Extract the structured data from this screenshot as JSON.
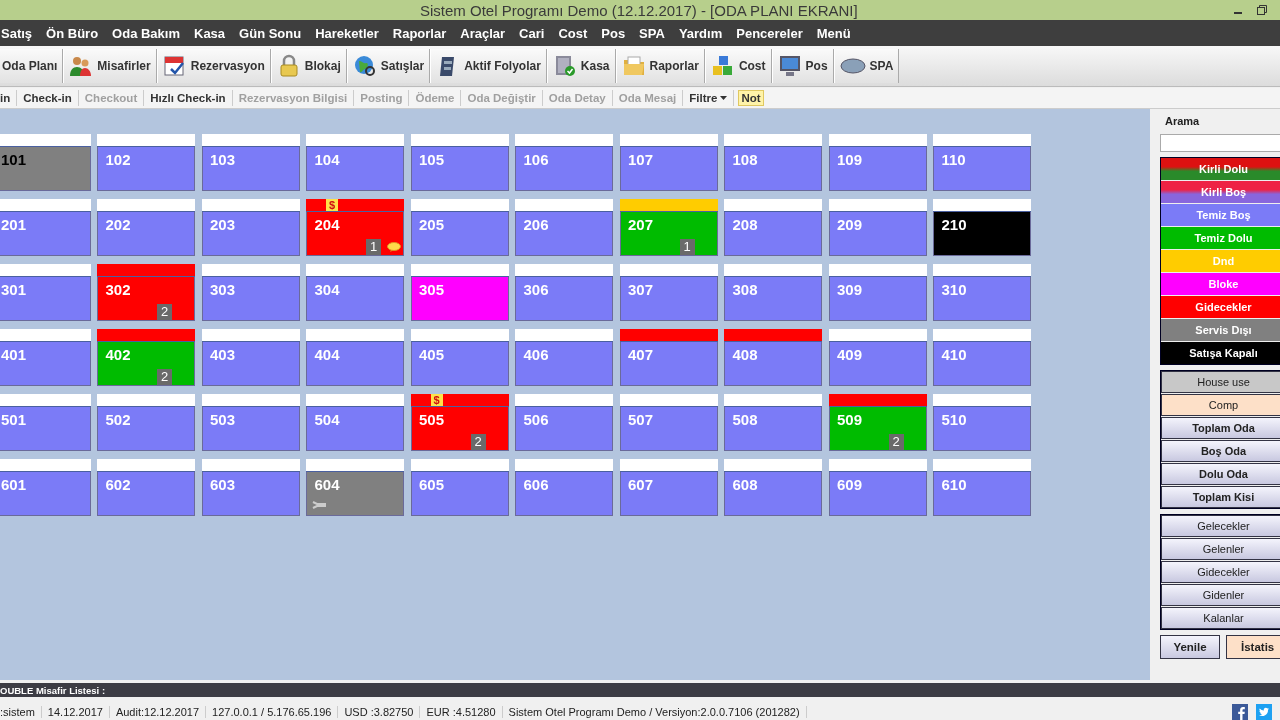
{
  "window": {
    "title": "Sistem Otel Programı Demo (12.12.2017) - [ODA PLANI EKRANI]"
  },
  "menu": [
    "Satış",
    "Ön Büro",
    "Oda Bakım",
    "Kasa",
    "Gün Sonu",
    "Hareketler",
    "Raporlar",
    "Araçlar",
    "Cari",
    "Cost",
    "Pos",
    "SPA",
    "Yardım",
    "Pencereler",
    "Menü"
  ],
  "toolbar": [
    {
      "label": "Oda Planı",
      "kind": "none"
    },
    {
      "label": "Misafirler",
      "kind": "people"
    },
    {
      "label": "Rezervasyon",
      "kind": "calendar"
    },
    {
      "label": "Blokaj",
      "kind": "lock"
    },
    {
      "label": "Satışlar",
      "kind": "globe"
    },
    {
      "label": "Aktif Folyolar",
      "kind": "cabinet"
    },
    {
      "label": "Kasa",
      "kind": "safe"
    },
    {
      "label": "Raporlar",
      "kind": "folder"
    },
    {
      "label": "Cost",
      "kind": "cubes"
    },
    {
      "label": "Pos",
      "kind": "monitor"
    },
    {
      "label": "SPA",
      "kind": "oval"
    }
  ],
  "actions": [
    {
      "label": "in",
      "disabled": false,
      "kind": "item"
    },
    {
      "label": "Check-in",
      "disabled": false,
      "kind": "item"
    },
    {
      "label": "Checkout",
      "disabled": true,
      "kind": "item"
    },
    {
      "label": "Hızlı Check-in",
      "disabled": false,
      "kind": "item"
    },
    {
      "label": "Rezervasyon Bilgisi",
      "disabled": true,
      "kind": "item"
    },
    {
      "label": "Posting",
      "disabled": true,
      "kind": "item"
    },
    {
      "label": "Ödeme",
      "disabled": true,
      "kind": "item"
    },
    {
      "label": "Oda Değiştir",
      "disabled": true,
      "kind": "item"
    },
    {
      "label": "Oda Detay",
      "disabled": true,
      "kind": "item"
    },
    {
      "label": "Oda Mesaj",
      "disabled": true,
      "kind": "item"
    },
    {
      "label": "Filtre",
      "disabled": false,
      "kind": "dropdown"
    },
    {
      "label": "Not",
      "disabled": false,
      "kind": "highlight"
    }
  ],
  "rooms": [
    [
      {
        "no": "101",
        "color": "#808080",
        "strip": {
          "color": "#ffffff"
        },
        "selected": true
      },
      {
        "no": "102",
        "color": "#7b7bf7",
        "strip": {
          "color": "#ffffff"
        },
        "selected": false
      },
      {
        "no": "103",
        "color": "#7b7bf7",
        "strip": {
          "color": "#ffffff"
        },
        "selected": false
      },
      {
        "no": "104",
        "color": "#7b7bf7",
        "strip": {
          "color": "#ffffff"
        },
        "selected": false
      },
      {
        "no": "105",
        "color": "#7b7bf7",
        "strip": {
          "color": "#ffffff"
        },
        "selected": false
      },
      {
        "no": "106",
        "color": "#7b7bf7",
        "strip": {
          "color": "#ffffff"
        },
        "selected": false
      },
      {
        "no": "107",
        "color": "#7b7bf7",
        "strip": {
          "color": "#ffffff"
        },
        "selected": false
      },
      {
        "no": "108",
        "color": "#7b7bf7",
        "strip": {
          "color": "#ffffff"
        },
        "selected": false
      },
      {
        "no": "109",
        "color": "#7b7bf7",
        "strip": {
          "color": "#ffffff"
        },
        "selected": false
      },
      {
        "no": "110",
        "color": "#7b7bf7",
        "strip": {
          "color": "#ffffff"
        },
        "selected": false
      }
    ],
    [
      {
        "no": "201",
        "color": "#7b7bf7",
        "strip": {
          "color": "#ffffff"
        },
        "selected": false
      },
      {
        "no": "202",
        "color": "#7b7bf7",
        "strip": {
          "color": "#ffffff"
        },
        "selected": false
      },
      {
        "no": "203",
        "color": "#7b7bf7",
        "strip": {
          "color": "#ffffff"
        },
        "selected": false
      },
      {
        "no": "204",
        "color": "#ff0000",
        "strip": {
          "color": "#ff0000"
        },
        "selected": false,
        "flag": "$",
        "guests": "1",
        "kind": "note"
      },
      {
        "no": "205",
        "color": "#7b7bf7",
        "strip": {
          "color": "#ffffff"
        },
        "selected": false
      },
      {
        "no": "206",
        "color": "#7b7bf7",
        "strip": {
          "color": "#ffffff"
        },
        "selected": false
      },
      {
        "no": "207",
        "color": "#00bb00",
        "strip": {
          "color": "#ffcc00"
        },
        "selected": false,
        "guests": "1"
      },
      {
        "no": "208",
        "color": "#7b7bf7",
        "strip": {
          "color": "#ffffff"
        },
        "selected": false
      },
      {
        "no": "209",
        "color": "#7b7bf7",
        "strip": {
          "color": "#ffffff"
        },
        "selected": false
      },
      {
        "no": "210",
        "color": "#000000",
        "strip": {
          "color": "#ffffff"
        },
        "selected": false
      }
    ],
    [
      {
        "no": "301",
        "color": "#7b7bf7",
        "strip": {
          "color": "#ffffff"
        },
        "selected": false
      },
      {
        "no": "302",
        "color": "#ff0000",
        "strip": {
          "color": "#ff0000"
        },
        "selected": false,
        "guests": "2"
      },
      {
        "no": "303",
        "color": "#7b7bf7",
        "strip": {
          "color": "#ffffff"
        },
        "selected": false
      },
      {
        "no": "304",
        "color": "#7b7bf7",
        "strip": {
          "color": "#ffffff"
        },
        "selected": false
      },
      {
        "no": "305",
        "color": "#ff00ff",
        "strip": {
          "color": "#ffffff"
        },
        "selected": false
      },
      {
        "no": "306",
        "color": "#7b7bf7",
        "strip": {
          "color": "#ffffff"
        },
        "selected": false
      },
      {
        "no": "307",
        "color": "#7b7bf7",
        "strip": {
          "color": "#ffffff"
        },
        "selected": false
      },
      {
        "no": "308",
        "color": "#7b7bf7",
        "strip": {
          "color": "#ffffff"
        },
        "selected": false
      },
      {
        "no": "309",
        "color": "#7b7bf7",
        "strip": {
          "color": "#ffffff"
        },
        "selected": false
      },
      {
        "no": "310",
        "color": "#7b7bf7",
        "strip": {
          "color": "#ffffff"
        },
        "selected": false
      }
    ],
    [
      {
        "no": "401",
        "color": "#7b7bf7",
        "strip": {
          "color": "#ffffff"
        },
        "selected": false
      },
      {
        "no": "402",
        "color": "#00bb00",
        "strip": {
          "color": "#ff0000"
        },
        "selected": false,
        "guests": "2"
      },
      {
        "no": "403",
        "color": "#7b7bf7",
        "strip": {
          "color": "#ffffff"
        },
        "selected": false
      },
      {
        "no": "404",
        "color": "#7b7bf7",
        "strip": {
          "color": "#ffffff"
        },
        "selected": false
      },
      {
        "no": "405",
        "color": "#7b7bf7",
        "strip": {
          "color": "#ffffff"
        },
        "selected": false
      },
      {
        "no": "406",
        "color": "#7b7bf7",
        "strip": {
          "color": "#ffffff"
        },
        "selected": false
      },
      {
        "no": "407",
        "color": "#7b7bf7",
        "strip": {
          "color": "#ff0000"
        },
        "selected": false
      },
      {
        "no": "408",
        "color": "#7b7bf7",
        "strip": {
          "color": "#ff0000"
        },
        "selected": false
      },
      {
        "no": "409",
        "color": "#7b7bf7",
        "strip": {
          "color": "#ffffff"
        },
        "selected": false
      },
      {
        "no": "410",
        "color": "#7b7bf7",
        "strip": {
          "color": "#ffffff"
        },
        "selected": false
      }
    ],
    [
      {
        "no": "501",
        "color": "#7b7bf7",
        "strip": {
          "color": "#ffffff"
        },
        "selected": false
      },
      {
        "no": "502",
        "color": "#7b7bf7",
        "strip": {
          "color": "#ffffff"
        },
        "selected": false
      },
      {
        "no": "503",
        "color": "#7b7bf7",
        "strip": {
          "color": "#ffffff"
        },
        "selected": false
      },
      {
        "no": "504",
        "color": "#7b7bf7",
        "strip": {
          "color": "#ffffff"
        },
        "selected": false
      },
      {
        "no": "505",
        "color": "#ff0000",
        "strip": {
          "color": "#ff0000"
        },
        "selected": false,
        "flag": "$",
        "guests": "2"
      },
      {
        "no": "506",
        "color": "#7b7bf7",
        "strip": {
          "color": "#ffffff"
        },
        "selected": false
      },
      {
        "no": "507",
        "color": "#7b7bf7",
        "strip": {
          "color": "#ffffff"
        },
        "selected": false
      },
      {
        "no": "508",
        "color": "#7b7bf7",
        "strip": {
          "color": "#ffffff"
        },
        "selected": false
      },
      {
        "no": "509",
        "color": "#00bb00",
        "strip": {
          "color": "#ff0000"
        },
        "selected": false,
        "guests": "2"
      },
      {
        "no": "510",
        "color": "#7b7bf7",
        "strip": {
          "color": "#ffffff"
        },
        "selected": false
      }
    ],
    [
      {
        "no": "601",
        "color": "#7b7bf7",
        "strip": {
          "color": "#ffffff"
        },
        "selected": false
      },
      {
        "no": "602",
        "color": "#7b7bf7",
        "strip": {
          "color": "#ffffff"
        },
        "selected": false
      },
      {
        "no": "603",
        "color": "#7b7bf7",
        "strip": {
          "color": "#ffffff"
        },
        "selected": false
      },
      {
        "no": "604",
        "color": "#808080",
        "strip": {
          "color": "#ffffff"
        },
        "selected": false,
        "kind": "wrench"
      },
      {
        "no": "605",
        "color": "#7b7bf7",
        "strip": {
          "color": "#ffffff"
        },
        "selected": false
      },
      {
        "no": "606",
        "color": "#7b7bf7",
        "strip": {
          "color": "#ffffff"
        },
        "selected": false
      },
      {
        "no": "607",
        "color": "#7b7bf7",
        "strip": {
          "color": "#ffffff"
        },
        "selected": false
      },
      {
        "no": "608",
        "color": "#7b7bf7",
        "strip": {
          "color": "#ffffff"
        },
        "selected": false
      },
      {
        "no": "609",
        "color": "#7b7bf7",
        "strip": {
          "color": "#ffffff"
        },
        "selected": false
      },
      {
        "no": "610",
        "color": "#7b7bf7",
        "strip": {
          "color": "#ffffff"
        },
        "selected": false
      }
    ]
  ],
  "sidebar": {
    "search_label": "Arama",
    "legend": [
      {
        "label": "Kirli Dolu",
        "color": "#dd1111",
        "end": {
          "color": "#2a8a2a"
        }
      },
      {
        "label": "Kirli Boş",
        "color": "#ee2244",
        "end": {
          "color": "#8866dd"
        }
      },
      {
        "label": "Temiz Boş",
        "color": "#7b7bf7"
      },
      {
        "label": "Temiz Dolu",
        "color": "#00bb00"
      },
      {
        "label": "Dnd",
        "color": "#ffcc00"
      },
      {
        "label": "Bloke",
        "color": "#ff00ff"
      },
      {
        "label": "Gidecekler",
        "color": "#ff0000"
      },
      {
        "label": "Servis Dışı",
        "color": "#808080"
      },
      {
        "label": "Satışa Kapalı",
        "color": "#000000"
      }
    ],
    "stats": [
      {
        "label": "House use",
        "kind": "house"
      },
      {
        "label": "Comp",
        "kind": "comp"
      },
      {
        "label": "Toplam Oda",
        "kind": "bold"
      },
      {
        "label": "Boş Oda",
        "kind": "bold"
      },
      {
        "label": "Dolu Oda",
        "kind": "bold"
      },
      {
        "label": "Toplam Kisi",
        "kind": "bold"
      }
    ],
    "lists": [
      "Gelecekler",
      "Gelenler",
      "Gidecekler",
      "Gidenler",
      "Kalanlar"
    ],
    "buttons": [
      {
        "label": "Yenile",
        "kind": "plain"
      },
      {
        "label": "İstatis",
        "kind": "comp"
      }
    ]
  },
  "guest_list": {
    "label": "OUBLE Misafir Listesi :"
  },
  "status_bar": [
    ":sistem",
    "14.12.2017",
    "Audit:12.12.2017",
    "127.0.0.1 / 5.176.65.196",
    "USD :3.82750",
    "EUR :4.51280",
    "Sistem Otel Programı Demo / Versiyon:2.0.0.7106 (201282)"
  ]
}
